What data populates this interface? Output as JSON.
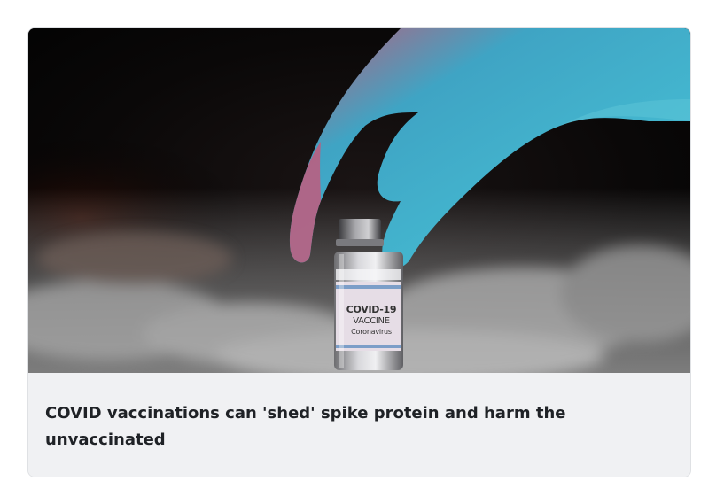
{
  "card": {
    "title": "COVID vaccinations can 'shed' spike protein and harm the unvaccinated",
    "image": {
      "vial_label_line1": "COVID-19",
      "vial_label_line2": "VACCINE",
      "vial_label_line3": "Coronavirus",
      "glove_color": "#3fb6cc",
      "background_color": "#050505",
      "smoke_color": "#c9c9c9"
    },
    "caption_background": "#f0f1f3"
  }
}
